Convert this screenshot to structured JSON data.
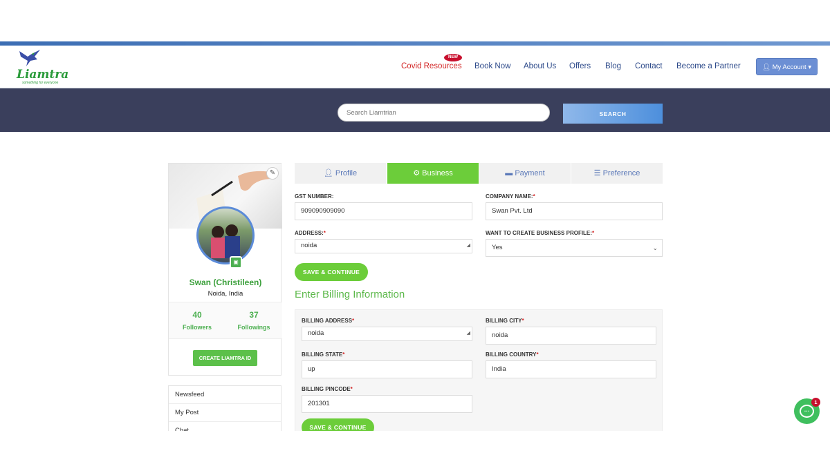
{
  "brand": {
    "name": "Liamtra",
    "tagline": "something for everyone"
  },
  "nav": {
    "items": [
      {
        "label": "Covid Resources",
        "badge": "NEW"
      },
      {
        "label": "Book Now"
      },
      {
        "label": "About Us"
      },
      {
        "label": "Offers"
      },
      {
        "label": "Blog"
      },
      {
        "label": "Contact"
      },
      {
        "label": "Become a Partner"
      }
    ],
    "account_label": "My Account"
  },
  "search": {
    "placeholder": "Search Liamtrian",
    "button_label": "SEARCH"
  },
  "profile": {
    "name": "Swan (Christileen)",
    "location": "Noida, India",
    "followers_count": "40",
    "followers_label": "Followers",
    "followings_count": "37",
    "followings_label": "Followings",
    "create_button": "CREATE LIAMTRA ID",
    "menu": [
      "Newsfeed",
      "My Post",
      "Chat"
    ]
  },
  "tabs": [
    {
      "label": "Profile",
      "icon": "user-gear-icon"
    },
    {
      "label": "Business",
      "icon": "cog-icon",
      "active": true
    },
    {
      "label": "Payment",
      "icon": "credit-card-icon"
    },
    {
      "label": "Preference",
      "icon": "list-icon"
    }
  ],
  "business_form": {
    "gst_label": "GST NUMBER:",
    "gst_value": "909090909090",
    "company_label": "COMPANY NAME:",
    "company_value": "Swan Pvt. Ltd",
    "address_label": "ADDRESS:",
    "address_value": "noida",
    "business_profile_label": "WANT TO CREATE BUSINESS PROFILE:",
    "business_profile_value": "Yes",
    "save_label": "SAVE & CONTINUE"
  },
  "billing": {
    "title": "Enter Billing Information",
    "address_label": "BILLING ADDRESS",
    "address_value": "noida",
    "city_label": "BILLING CITY",
    "city_value": "noida",
    "state_label": "BILLING STATE",
    "state_value": "up",
    "country_label": "BILLING COUNTRY",
    "country_value": "India",
    "pincode_label": "BILLING PINCODE",
    "pincode_value": "201301",
    "save_label": "SAVE & CONTINUE"
  },
  "chat_widget": {
    "unread": "1"
  },
  "colors": {
    "accent_green": "#6ccd3a",
    "nav_blue": "#2d4a8a",
    "band": "#3a3f5c",
    "alert_red": "#d22424"
  }
}
